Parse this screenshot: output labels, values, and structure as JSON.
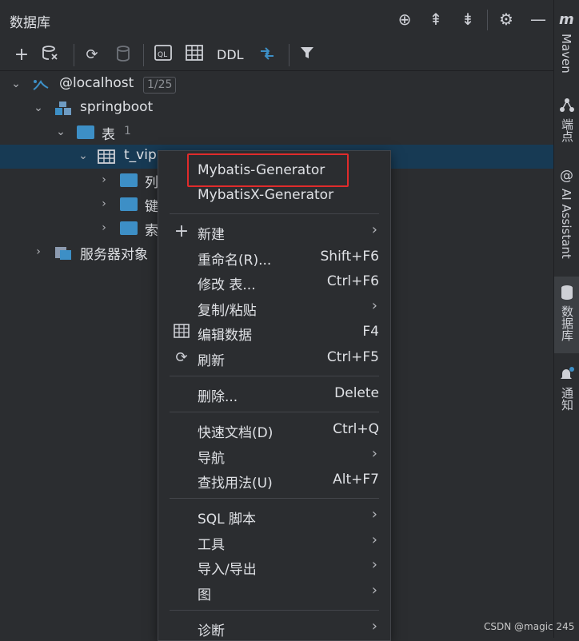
{
  "header": {
    "title": "数据库"
  },
  "toolbar": {
    "ddl_label": "DDL"
  },
  "tree": {
    "host": {
      "label": "@localhost",
      "badge": "1/25"
    },
    "schema": {
      "label": "springboot"
    },
    "tables_folder": {
      "label": "表",
      "count": "1"
    },
    "table": {
      "label": "t_vip"
    },
    "columns": {
      "label": "列"
    },
    "keys": {
      "label": "键"
    },
    "indexes": {
      "label": "索"
    },
    "server_objects": {
      "label": "服务器对象"
    }
  },
  "context_menu": {
    "items": [
      {
        "label": "Mybatis-Generator"
      },
      {
        "label": "MybatisX-Generator"
      },
      {
        "label": "新建",
        "icon": "plus-icon"
      },
      {
        "label": "重命名(R)...",
        "shortcut": "Shift+F6"
      },
      {
        "label": "修改 表...",
        "shortcut": "Ctrl+F6"
      },
      {
        "label": "复制/粘贴"
      },
      {
        "label": "编辑数据",
        "shortcut": "F4",
        "icon": "table-icon"
      },
      {
        "label": "刷新",
        "shortcut": "Ctrl+F5",
        "icon": "refresh-icon"
      },
      {
        "label": "删除...",
        "shortcut": "Delete"
      },
      {
        "label": "快速文档(D)",
        "shortcut": "Ctrl+Q"
      },
      {
        "label": "导航"
      },
      {
        "label": "查找用法(U)",
        "shortcut": "Alt+F7"
      },
      {
        "label": "SQL 脚本"
      },
      {
        "label": "工具"
      },
      {
        "label": "导入/导出"
      },
      {
        "label": "图"
      },
      {
        "label": "诊断"
      }
    ]
  },
  "right_sidebar": {
    "maven": "Maven",
    "endpoints": "端点",
    "ai_assistant": "AI Assistant",
    "database": "数据库",
    "notifications": "通知"
  },
  "watermark": "CSDN @magic 245",
  "colors": {
    "accent": "#3d8fc6",
    "selection": "#173a54",
    "highlight_border": "#e02b2b"
  }
}
